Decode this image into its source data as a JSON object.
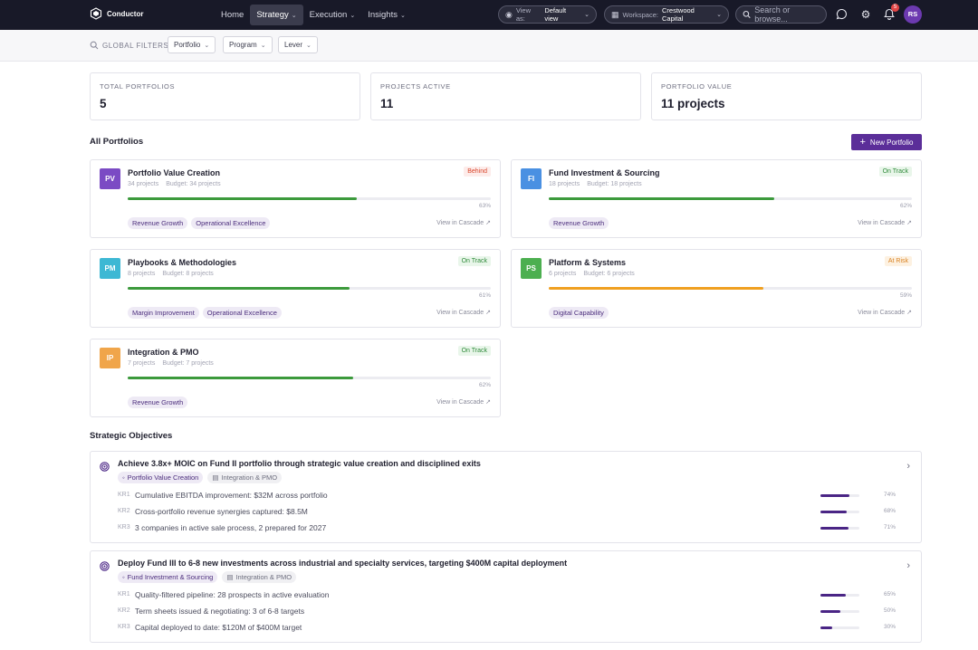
{
  "app": {
    "name": "Conductor"
  },
  "nav": [
    {
      "label": "Home",
      "caret": false,
      "active": false
    },
    {
      "label": "Strategy",
      "caret": true,
      "active": true
    },
    {
      "label": "Execution",
      "caret": true,
      "active": false
    },
    {
      "label": "Insights",
      "caret": true,
      "active": false
    }
  ],
  "view": {
    "label": "View as:",
    "value": "Default view"
  },
  "workspace": {
    "label": "Workspace:",
    "value": "Crestwood Capital"
  },
  "search": {
    "placeholder": "Search or browse..."
  },
  "notifications": {
    "count": "5"
  },
  "user": {
    "initials": "RS"
  },
  "filters": {
    "label": "GLOBAL FILTERS",
    "items": [
      "Portfolio",
      "Program",
      "Lever"
    ]
  },
  "stats": [
    {
      "label": "TOTAL PORTFOLIOS",
      "value": "5"
    },
    {
      "label": "PROJECTS ACTIVE",
      "value": "11"
    },
    {
      "label": "PORTFOLIO VALUE",
      "value": "11 projects"
    }
  ],
  "portfolios_section": {
    "title": "All Portfolios",
    "new_button": "New Portfolio"
  },
  "portfolios": [
    {
      "initials": "PV",
      "name": "Portfolio Value Creation",
      "projects": "34 projects",
      "budget": "Budget: 34 projects",
      "status": "Behind",
      "progress": 63,
      "pct": "63%",
      "tags": [
        "Revenue Growth",
        "Operational Excellence"
      ],
      "cascade": "View in Cascade",
      "color": "#7b4bc4"
    },
    {
      "initials": "FI",
      "name": "Fund Investment & Sourcing",
      "projects": "18 projects",
      "budget": "Budget: 18 projects",
      "status": "On Track",
      "progress": 62,
      "pct": "62%",
      "tags": [
        "Revenue Growth"
      ],
      "cascade": "View in Cascade",
      "color": "#4a90e2"
    },
    {
      "initials": "PM",
      "name": "Playbooks & Methodologies",
      "projects": "8 projects",
      "budget": "Budget: 8 projects",
      "status": "On Track",
      "progress": 61,
      "pct": "61%",
      "tags": [
        "Margin Improvement",
        "Operational Excellence"
      ],
      "cascade": "View in Cascade",
      "color": "#3db8d4"
    },
    {
      "initials": "PS",
      "name": "Platform & Systems",
      "projects": "6 projects",
      "budget": "Budget: 6 projects",
      "status": "At Risk",
      "progress": 59,
      "pct": "59%",
      "tags": [
        "Digital Capability"
      ],
      "cascade": "View in Cascade",
      "color": "#4caf50"
    },
    {
      "initials": "IP",
      "name": "Integration & PMO",
      "projects": "7 projects",
      "budget": "Budget: 7 projects",
      "status": "On Track",
      "progress": 62,
      "pct": "62%",
      "tags": [
        "Revenue Growth"
      ],
      "cascade": "View in Cascade",
      "color": "#f0a54a"
    }
  ],
  "status_colors": {
    "Behind": {
      "bg": "#fdecea",
      "fg": "#d9452b",
      "bar": "#3c9a3c"
    },
    "On Track": {
      "bg": "#e9f6ea",
      "fg": "#2f8a3a",
      "bar": "#3c9a3c"
    },
    "At Risk": {
      "bg": "#fdf1e1",
      "fg": "#d98324",
      "bar": "#f0a020"
    }
  },
  "objectives_section": {
    "title": "Strategic Objectives"
  },
  "objectives": [
    {
      "title": "Achieve 3.8x+ MOIC on Fund II portfolio through strategic value creation and disciplined exits",
      "tags": [
        "Portfolio Value Creation",
        "Integration & PMO"
      ],
      "krs": [
        {
          "id": "KR1",
          "text": "Cumulative EBITDA improvement: $32M across portfolio",
          "progress": 74,
          "pct": "74%"
        },
        {
          "id": "KR2",
          "text": "Cross-portfolio revenue synergies captured: $8.5M",
          "progress": 68,
          "pct": "68%"
        },
        {
          "id": "KR3",
          "text": "3 companies in active sale process, 2 prepared for 2027",
          "progress": 71,
          "pct": "71%"
        }
      ]
    },
    {
      "title": "Deploy Fund III to 6-8 new investments across industrial and specialty services, targeting $400M capital deployment",
      "tags": [
        "Fund Investment & Sourcing",
        "Integration & PMO"
      ],
      "krs": [
        {
          "id": "KR1",
          "text": "Quality-filtered pipeline: 28 prospects in active evaluation",
          "progress": 65,
          "pct": "65%"
        },
        {
          "id": "KR2",
          "text": "Term sheets issued & negotiating: 3 of 6-8 targets",
          "progress": 50,
          "pct": "50%"
        },
        {
          "id": "KR3",
          "text": "Capital deployed to date: $120M of $400M target",
          "progress": 30,
          "pct": "30%"
        }
      ]
    }
  ]
}
